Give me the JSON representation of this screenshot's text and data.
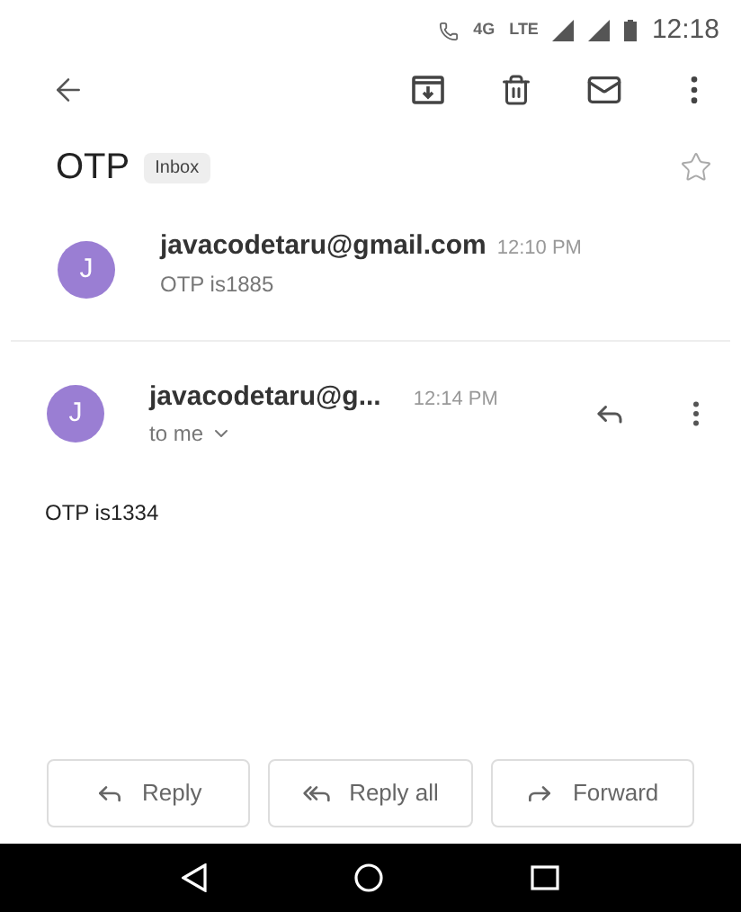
{
  "status_bar": {
    "network_labels": [
      "4G",
      "LTE"
    ],
    "time": "12:18"
  },
  "subject": {
    "title": "OTP",
    "label": "Inbox",
    "starred": false
  },
  "messages": [
    {
      "kind": "collapsed",
      "avatar": "J",
      "sender": "javacodetaru@gmail.com",
      "time": "12:10 PM",
      "snippet": "OTP is1885"
    },
    {
      "kind": "expanded",
      "avatar": "J",
      "sender": "javacodetaru@g...",
      "time": "12:14 PM",
      "recipient": "to me",
      "body": "OTP is1334"
    }
  ],
  "actions": [
    {
      "kind": "reply",
      "label": "Reply"
    },
    {
      "kind": "reply_all",
      "label": "Reply all"
    },
    {
      "kind": "forward",
      "label": "Forward"
    }
  ]
}
